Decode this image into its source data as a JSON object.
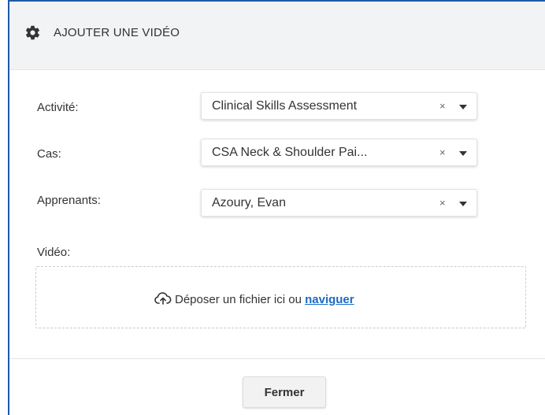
{
  "dialog": {
    "title": "AJOUTER UNE VIDÉO",
    "title_icon": "gear-icon"
  },
  "form": {
    "activity": {
      "label": "Activité:",
      "value": "Clinical Skills Assessment"
    },
    "case": {
      "label": "Cas:",
      "value": "CSA Neck & Shoulder Pai..."
    },
    "learners": {
      "label": "Apprenants:",
      "value": "Azoury, Evan"
    },
    "clear_symbol": "×",
    "video": {
      "label": "Vidéo:",
      "dropzone_text": "Déposer un fichier ici ou ",
      "browse_link": "naviguer",
      "upload_icon": "cloud-upload-icon"
    }
  },
  "footer": {
    "close_label": "Fermer"
  },
  "colors": {
    "accent_border": "#1e5aa8",
    "link": "#1a6bc4",
    "header_bg": "#f1f3f4"
  }
}
